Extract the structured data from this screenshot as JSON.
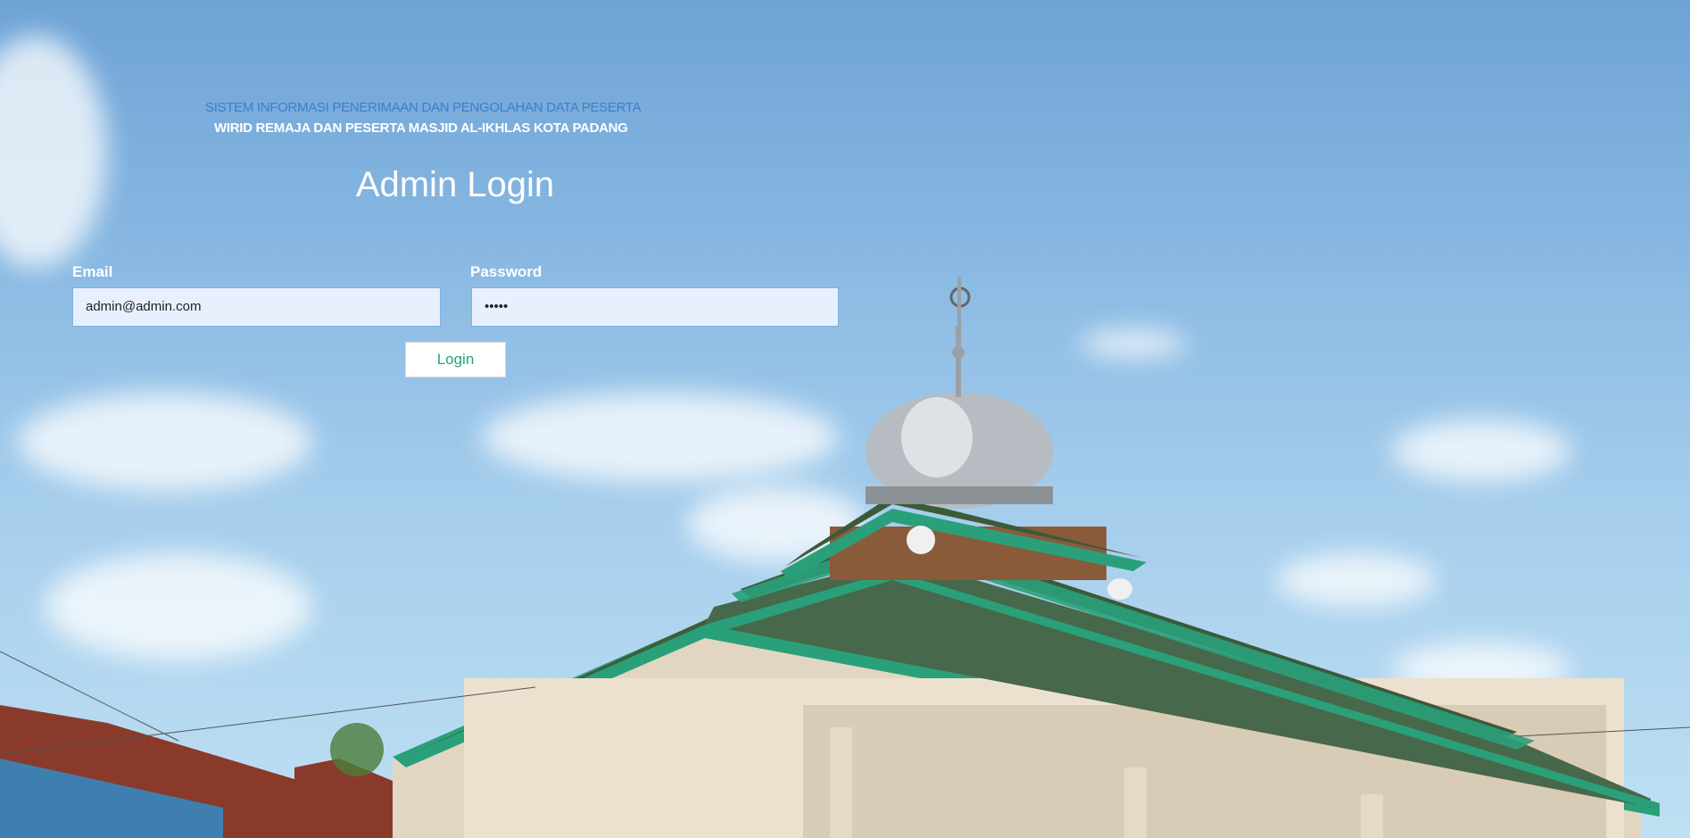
{
  "header": {
    "line1": "SISTEM INFORMASI PENERIMAAN DAN PENGOLAHAN DATA PESERTA",
    "line2": "WIRID REMAJA DAN PESERTA MASJID AL-IKHLAS KOTA PADANG"
  },
  "title": "Admin Login",
  "form": {
    "email_label": "Email",
    "email_value": "admin@admin.com",
    "password_label": "Password",
    "password_value": "•••••",
    "login_label": "Login"
  },
  "colors": {
    "header_blue": "#3d7fc6",
    "button_text": "#27a27a",
    "input_bg": "#e8f0fe"
  }
}
